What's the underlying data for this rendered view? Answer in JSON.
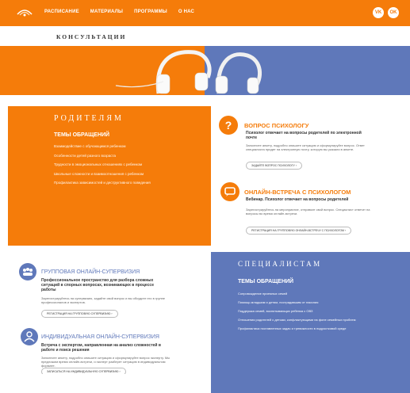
{
  "nav": {
    "items": [
      "РАСПИСАНИЕ",
      "МАТЕРИАЛЫ",
      "ПРОГРАММЫ",
      "О НАС"
    ],
    "social": [
      "VK",
      "OK"
    ]
  },
  "page_title": "КОНСУЛЬТАЦИИ",
  "parents": {
    "title": "РОДИТЕЛЯМ",
    "subtitle": "ТЕМЫ ОБРАЩЕНИЙ",
    "topics": [
      "Взаимодействие с обучающимся ребенком",
      "Особенности детей разного возраста",
      "Трудности в эмоциональных отношениях с ребенком",
      "Школьные сложности и взаимоотношения с ребенком",
      "Профилактика зависимостей и деструктивного поведения"
    ]
  },
  "psych_question": {
    "icon": "question-mark",
    "title": "ВОПРОС ПСИХОЛОГУ",
    "subtitle": "Психолог отвечает на вопросы родителей по электронной почте",
    "text": "Заполните анкету, подробно опишите ситуацию и сформулируйте вопрос. Ответ специалиста придет на электронную почту, которую вы указали в анкете.",
    "button": "ЗАДАЙТЕ ВОПРОС ПСИХОЛОГУ"
  },
  "online_meeting": {
    "icon": "chat-bubble",
    "title": "ОНЛАЙН-ВСТРЕЧА С ПСИХОЛОГОМ",
    "subtitle": "Вебинар. Психолог отвечает на вопросы родителей",
    "text": "Зарегистрируйтесь на мероприятие, отправьте свой вопрос. Специалист ответит на вопросы во время онлайн-встречи.",
    "button": "РЕГИСТРАЦИЯ НА ГРУППОВУЮ ОНЛАЙН-ВСТРЕЧУ С ПСИХОЛОГОМ"
  },
  "group_supervision": {
    "icon": "group",
    "title": "ГРУППОВАЯ ОНЛАЙН-СУПЕРВИЗИЯ",
    "subtitle": "Профессиональное пространство для разбора сложных ситуаций в спорных вопросах, возникающих в процессе работы",
    "text": "Зарегистрируйтесь на супервизию, задайте свой вопрос и вы обсудите его в группе профессионалов и экспертов.",
    "button": "РЕГИСТРАЦИЯ НА ГРУППОВУЮ СУПЕРВИЗИЮ"
  },
  "individual_supervision": {
    "icon": "person",
    "title": "ИНДИВИДУАЛЬНАЯ ОНЛАЙН-СУПЕРВИЗИЯ",
    "subtitle": "Встреча с экспертом, направленная на анализ сложностей в работе и поиск решения",
    "text": "Заполните анкету, подробно опишите ситуацию и сформулируйте вопрос эксперту. Мы предложим время онлайн-встречи, и эксперт разберет ситуацию в индивидуальном формате.",
    "button": "ЗАПИСАТЬСЯ НА ИНДИВИДУАЛЬНУЮ СУПЕРВИЗИЮ"
  },
  "specialists": {
    "title": "СПЕЦИАЛИСТАМ",
    "subtitle": "ТЕМЫ ОБРАЩЕНИЙ",
    "topics": [
      "Сопровождение приемных семей",
      "Помощь младшим и детям, пострадавшим от насилия",
      "Поддержка семей, воспитывающих ребенка с ОВЗ",
      "Отношения родителей с детьми, конфликтующими на фоне семейных проблем",
      "Профилактика поставленных задач и тревожности в подростковой среде"
    ]
  },
  "colors": {
    "orange": "#f57c0a",
    "blue": "#5f78ba"
  }
}
